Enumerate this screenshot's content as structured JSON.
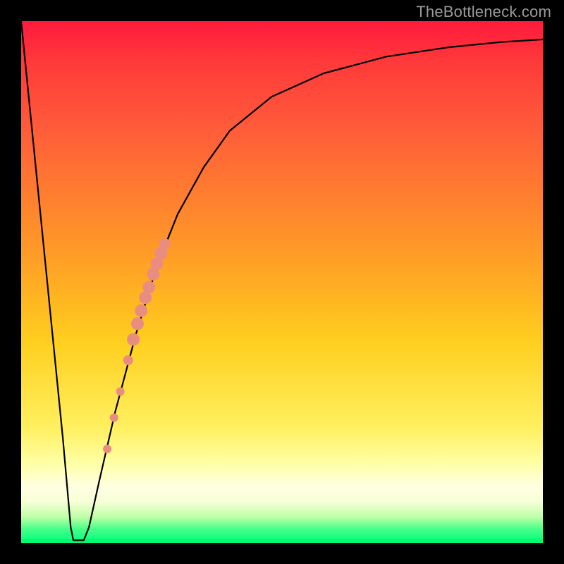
{
  "watermark": "TheBottleneck.com",
  "chart_data": {
    "type": "line",
    "title": "",
    "xlabel": "",
    "ylabel": "",
    "xlim": [
      0,
      100
    ],
    "ylim": [
      0,
      100
    ],
    "background_gradient": {
      "top": "#ff1a3c",
      "upper_mid": "#ff9a28",
      "mid": "#ffe040",
      "lower_mid": "#ffffe0",
      "bottom": "#00ff80"
    },
    "series": [
      {
        "name": "bottleneck-curve",
        "type": "line",
        "color": "#000000",
        "points": [
          {
            "x": 0.0,
            "y": 100.0
          },
          {
            "x": 2.0,
            "y": 80.0
          },
          {
            "x": 4.0,
            "y": 60.0
          },
          {
            "x": 6.0,
            "y": 40.0
          },
          {
            "x": 8.0,
            "y": 20.0
          },
          {
            "x": 9.5,
            "y": 3.0
          },
          {
            "x": 10.0,
            "y": 0.5
          },
          {
            "x": 11.0,
            "y": 0.5
          },
          {
            "x": 12.0,
            "y": 0.5
          },
          {
            "x": 13.0,
            "y": 3.0
          },
          {
            "x": 15.0,
            "y": 12.0
          },
          {
            "x": 18.0,
            "y": 25.0
          },
          {
            "x": 22.0,
            "y": 40.0
          },
          {
            "x": 26.0,
            "y": 53.0
          },
          {
            "x": 30.0,
            "y": 63.0
          },
          {
            "x": 35.0,
            "y": 72.0
          },
          {
            "x": 40.0,
            "y": 79.0
          },
          {
            "x": 48.0,
            "y": 85.5
          },
          {
            "x": 58.0,
            "y": 90.0
          },
          {
            "x": 70.0,
            "y": 93.2
          },
          {
            "x": 82.0,
            "y": 95.0
          },
          {
            "x": 92.0,
            "y": 96.0
          },
          {
            "x": 100.0,
            "y": 96.5
          }
        ]
      },
      {
        "name": "highlighted-range-dots",
        "type": "scatter",
        "color": "#e98d80",
        "points": [
          {
            "x": 16.5,
            "y": 18.0,
            "r": 6
          },
          {
            "x": 17.8,
            "y": 24.0,
            "r": 6
          },
          {
            "x": 19.0,
            "y": 29.0,
            "r": 6
          },
          {
            "x": 20.5,
            "y": 35.0,
            "r": 7
          },
          {
            "x": 21.5,
            "y": 39.0,
            "r": 9
          },
          {
            "x": 22.3,
            "y": 42.0,
            "r": 9
          },
          {
            "x": 23.0,
            "y": 44.5,
            "r": 9
          },
          {
            "x": 23.8,
            "y": 47.0,
            "r": 9
          },
          {
            "x": 24.5,
            "y": 49.0,
            "r": 9
          },
          {
            "x": 25.3,
            "y": 51.5,
            "r": 9
          },
          {
            "x": 26.0,
            "y": 53.5,
            "r": 9
          },
          {
            "x": 26.8,
            "y": 55.5,
            "r": 9
          },
          {
            "x": 27.5,
            "y": 57.3,
            "r": 8
          }
        ]
      }
    ]
  }
}
